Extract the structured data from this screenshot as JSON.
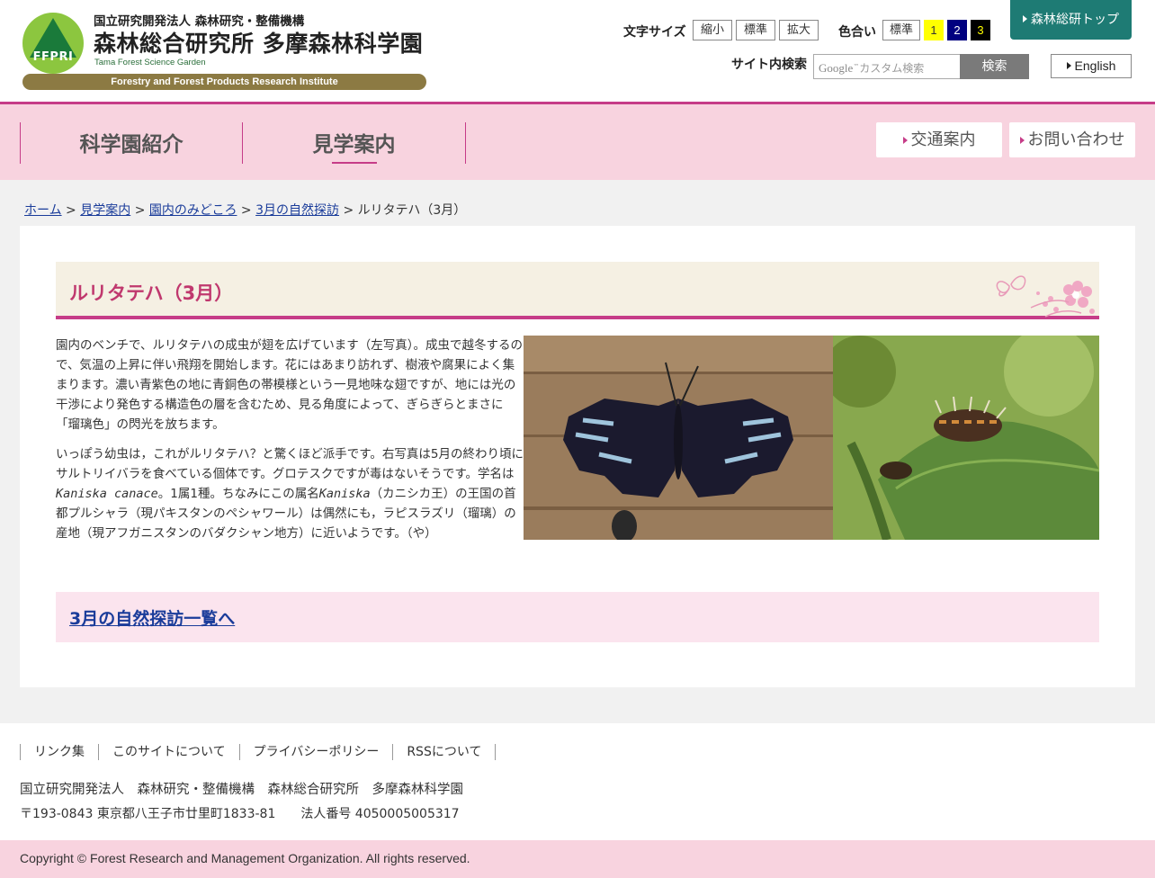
{
  "header": {
    "logo_text": "FFPRI",
    "org_small": "国立研究開発法人 森林研究・整備機構",
    "org_main": "森林総合研究所 多摩森林科学園",
    "org_en": "Tama Forest Science Garden",
    "org_bar": "Forestry and Forest Products Research Institute",
    "font_size_label": "文字サイズ",
    "font_size_buttons": [
      "縮小",
      "標準",
      "拡大"
    ],
    "color_label": "色合い",
    "color_buttons": [
      "標準",
      "1",
      "2",
      "3"
    ],
    "top_link": "森林総研トップ",
    "search_label": "サイト内検索",
    "search_google": "Google",
    "search_placeholder": "カスタム検索",
    "search_button": "検索",
    "english": "English"
  },
  "nav": {
    "items": [
      "科学園紹介",
      "見学案内"
    ],
    "buttons": [
      "交通案内",
      "お問い合わせ"
    ]
  },
  "breadcrumb": {
    "items": [
      "ホーム",
      "見学案内",
      "園内のみどころ",
      "3月の自然探訪"
    ],
    "current": "ルリタテハ（3月）",
    "separator": ">"
  },
  "page": {
    "title": "ルリタテハ（3月）",
    "para1": "園内のベンチで、ルリタテハの成虫が翅を広げています（左写真）。成虫で越冬するので、気温の上昇に伴い飛翔を開始します。花にはあまり訪れず、樹液や腐果によく集まります。濃い青紫色の地に青銅色の帯模様という一見地味な翅ですが、地には光の干渉により発色する構造色の層を含むため、見る角度によって、ぎらぎらとまさに「瑠璃色」の閃光を放ちます。",
    "para2_a": "いっぽう幼虫は，これがルリタテハ？と驚くほど派手です。右写真は5月の終わり頃にサルトリイバラを食べている個体です。グロテスクですが毒はないそうです。学名は",
    "para2_sci": "Kaniska canace",
    "para2_b": "。1属1種。ちなみにこの属名",
    "para2_genus": "Kaniska",
    "para2_c": "（カニシカ王）の王国の首都プルシャラ（現パキスタンのペシャワール）は偶然にも，ラピスラズリ（瑠璃）の産地（現アフガニスタンのバダクシャン地方）に近いようです。（や）",
    "more_link": "3月の自然探訪一覧へ"
  },
  "footer": {
    "links": [
      "リンク集",
      "このサイトについて",
      "プライバシーポリシー",
      "RSSについて"
    ],
    "org": "国立研究開発法人　森林研究・整備機構　森林総合研究所　多摩森林科学園",
    "address": "〒193-0843 東京都八王子市廿里町1833-81　　法人番号 4050005005317",
    "copyright": "Copyright © Forest Research and Management Organization. All rights reserved."
  },
  "colors": {
    "accent": "#c63c88",
    "nav_bg": "#f8d3df",
    "teal": "#1e7b74",
    "title_color": "#c0386e",
    "link": "#1a3c9a"
  }
}
